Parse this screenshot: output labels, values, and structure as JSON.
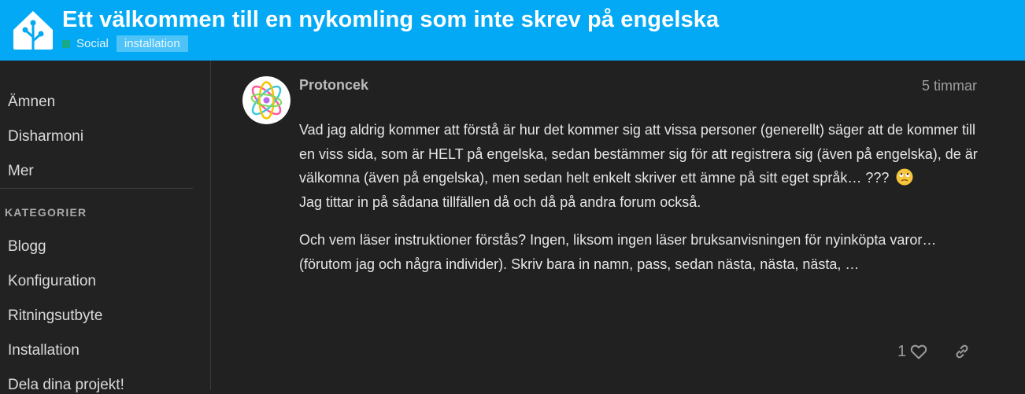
{
  "topic": {
    "title": "Ett välkommen till en nykomling som inte skrev på engelska",
    "category": "Social",
    "tag": "installation"
  },
  "colors": {
    "header_bg": "#03a9f4",
    "category_square": "#18a98a",
    "tag_bg": "#4dc3f7",
    "page_bg": "#212121"
  },
  "sidebar": {
    "items": [
      "Ämnen",
      "Disharmoni",
      "Mer"
    ],
    "categories_heading": "KATEGORIER",
    "categories": [
      "Blogg",
      "Konfiguration",
      "Ritningsutbyte",
      "Installation",
      "Dela dina projekt!"
    ]
  },
  "post": {
    "author": "Protoncek",
    "time": "5 timmar",
    "avatar_icon": "colorful-atom-avatar",
    "paragraph1_line1": "Vad jag aldrig kommer att förstå är hur det kommer sig att vissa personer (generellt) säger att de kommer till en viss sida, som är HELT på engelska, sedan bestämmer sig för att registrera sig (även på engelska), de är välkomna (även på engelska), men sedan helt enkelt skriver ett ämne på sitt eget språk… ???",
    "emoji": "face-with-rolling-eyes",
    "paragraph1_line2": "Jag tittar in på sådana tillfällen då och då på andra forum också.",
    "paragraph2": "Och vem läser instruktioner förstås? Ingen, liksom ingen läser bruksanvisningen för nyinköpta varor… (förutom jag och några individer). Skriv bara in namn, pass, sedan nästa, nästa, nästa, …",
    "like_count": "1",
    "like_icon": "heart-icon",
    "share_icon": "link-icon"
  }
}
